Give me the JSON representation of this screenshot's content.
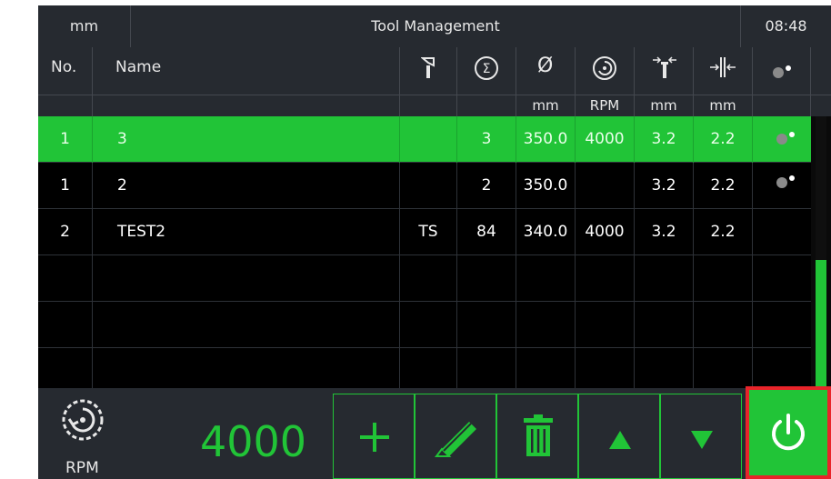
{
  "header": {
    "unit": "mm",
    "title": "Tool Management",
    "time": "08:48"
  },
  "columns": {
    "no": "No.",
    "name": "Name",
    "icons": [
      "tool-holder-icon",
      "sum-icon",
      "diameter-icon",
      "spindle-speed-icon",
      "tool-width-icon",
      "tool-length-icon",
      "coolant-icon"
    ],
    "diameter_symbol": "Ø",
    "sum_symbol": "Σ",
    "units": {
      "diameter": "mm",
      "rpm": "RPM",
      "width": "mm",
      "length": "mm"
    }
  },
  "rows": [
    {
      "no": "1",
      "name": "3",
      "type": "",
      "count": "3",
      "diameter": "350.0",
      "rpm": "4000",
      "width": "3.2",
      "length": "2.2",
      "coolant": true,
      "selected": true
    },
    {
      "no": "1",
      "name": "2",
      "type": "",
      "count": "2",
      "diameter": "350.0",
      "rpm": "",
      "width": "3.2",
      "length": "2.2",
      "coolant": true,
      "selected": false
    },
    {
      "no": "2",
      "name": "TEST2",
      "type": "TS",
      "count": "84",
      "diameter": "340.0",
      "rpm": "4000",
      "width": "3.2",
      "length": "2.2",
      "coolant": false,
      "selected": false
    }
  ],
  "footer": {
    "rpm_label": "RPM",
    "rpm_value": "4000",
    "buttons": [
      "add-button",
      "edit-button",
      "delete-button",
      "move-up-button",
      "move-down-button"
    ]
  },
  "colors": {
    "accent": "#21c437",
    "header_bg": "#262a30",
    "alert": "#e8242a"
  }
}
